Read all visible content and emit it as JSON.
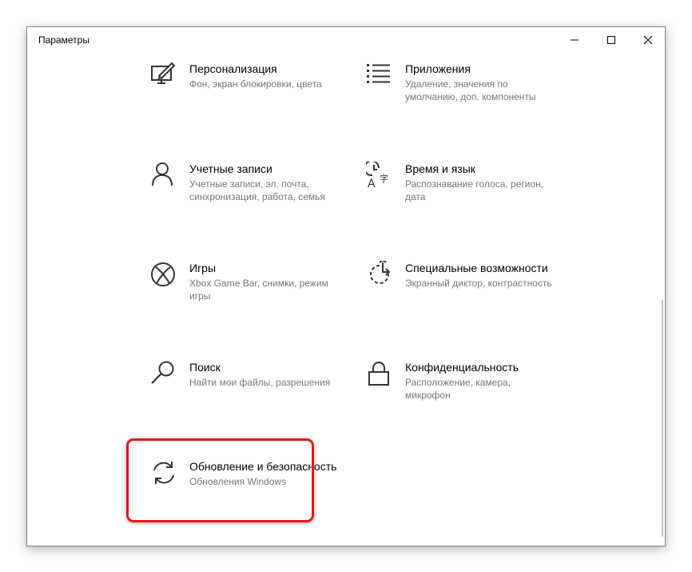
{
  "window": {
    "title": "Параметры",
    "controls": [
      "minimize-icon",
      "maximize-icon",
      "close-icon"
    ]
  },
  "tiles": [
    {
      "title": "Персонализация",
      "description": "Фон, экран блокировки, цвета",
      "icon": "personalization-icon"
    },
    {
      "title": "Приложения",
      "description": "Удаление, значения по умолчанию, доп. компоненты",
      "icon": "apps-icon"
    },
    {
      "title": "Учетные записи",
      "description": "Учетные записи, эл. почта, синхронизация, работа, семья",
      "icon": "accounts-icon"
    },
    {
      "title": "Время и язык",
      "description": "Распознавание голоса, регион, дата",
      "icon": "time-language-icon"
    },
    {
      "title": "Игры",
      "description": "Xbox Game Bar, снимки, режим игры",
      "icon": "xbox-icon"
    },
    {
      "title": "Специальные возможности",
      "description": "Экранный диктор, контрастность",
      "icon": "ease-of-access-icon"
    },
    {
      "title": "Поиск",
      "description": "Найти мои файлы, разрешения",
      "icon": "search-icon"
    },
    {
      "title": "Конфиденциальность",
      "description": "Расположение, камера, микрофон",
      "icon": "lock-icon"
    },
    {
      "title": "Обновление и безопасность",
      "description": "Обновления Windows",
      "icon": "update-icon"
    }
  ],
  "colors": {
    "highlight": "#e8161a",
    "description_text": "#767676",
    "icon": "#333333"
  }
}
